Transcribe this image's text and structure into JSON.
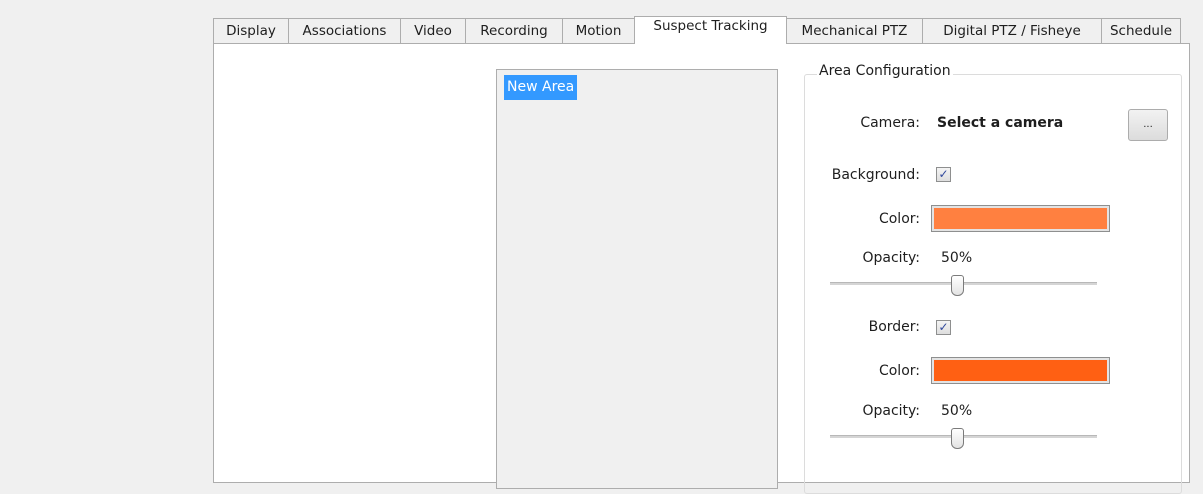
{
  "tabs": [
    {
      "label": "Display",
      "active": false
    },
    {
      "label": "Associations",
      "active": false
    },
    {
      "label": "Video",
      "active": false
    },
    {
      "label": "Recording",
      "active": false
    },
    {
      "label": "Motion",
      "active": false
    },
    {
      "label": "Suspect Tracking",
      "active": true
    },
    {
      "label": "Mechanical PTZ",
      "active": false
    },
    {
      "label": "Digital PTZ / Fisheye",
      "active": false
    },
    {
      "label": "Schedule",
      "active": false
    }
  ],
  "area_list": {
    "items": [
      {
        "label": "New Area",
        "selected": true
      }
    ]
  },
  "area_configuration": {
    "title": "Area Configuration",
    "camera": {
      "label": "Camera:",
      "value": "Select a camera",
      "browse_label": "..."
    },
    "background": {
      "label": "Background:",
      "checked": true,
      "color_label": "Color:",
      "color": "#ff8040",
      "opacity_label": "Opacity:",
      "opacity_value": "50%",
      "opacity_fraction": 0.5
    },
    "border": {
      "label": "Border:",
      "checked": true,
      "color_label": "Color:",
      "color": "#ff6013",
      "opacity_label": "Opacity:",
      "opacity_value": "50%",
      "opacity_fraction": 0.5
    }
  },
  "colors": {
    "selection": "#3399ff",
    "checkmark": "#30489c"
  }
}
